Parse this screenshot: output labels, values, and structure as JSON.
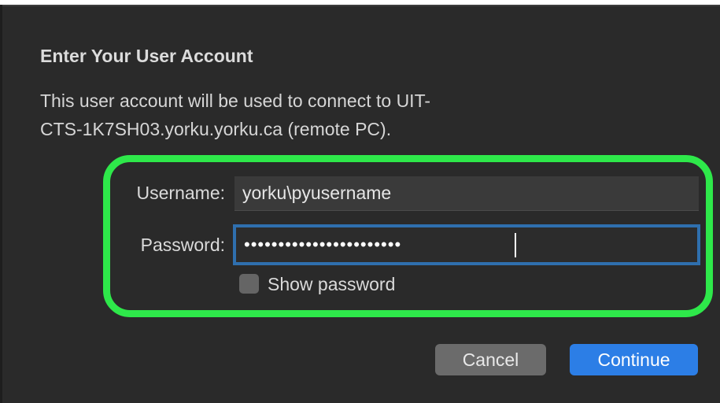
{
  "dialog": {
    "title": "Enter Your User Account",
    "message_line1": "This user account will be used to connect to UIT-",
    "message_line2": "CTS-1K7SH03.yorku.yorku.ca (remote PC)."
  },
  "form": {
    "username_label": "Username:",
    "username_value": "yorku\\pyusername",
    "password_label": "Password:",
    "password_value": "•••••••••••••••••••••••",
    "show_password_label": "Show password",
    "show_password_checked": false
  },
  "buttons": {
    "cancel_label": "Cancel",
    "continue_label": "Continue"
  },
  "colors": {
    "dialog_bg": "#2a2a2a",
    "highlight": "#2ee84a",
    "focus_ring": "#2f6fae",
    "primary_button": "#2c7ee6",
    "secondary_button": "#6b6b6b"
  }
}
